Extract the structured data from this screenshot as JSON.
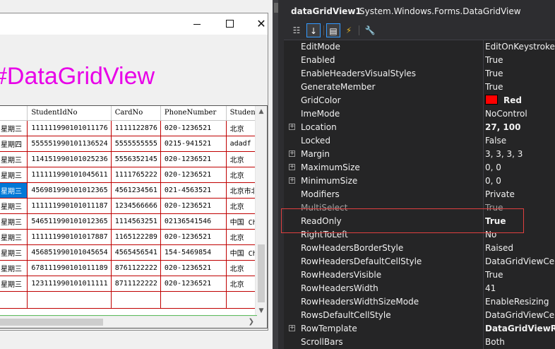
{
  "form": {
    "title": "#DataGridView",
    "window_buttons": {
      "close": "✕"
    }
  },
  "grid": {
    "columns": [
      "",
      "StudentIdNo",
      "CardNo",
      "PhoneNumber",
      "Student"
    ],
    "rows": [
      [
        "星期三",
        "111111990101011176",
        "1111122876",
        "020-1236521",
        "北京"
      ],
      [
        "星期四",
        "555551990101136524",
        "5555555555",
        "0215-941521",
        "adadf"
      ],
      [
        "星期三",
        "114151990101025236",
        "5556352145",
        "020-1236521",
        "北京"
      ],
      [
        "星期三",
        "111111990101045611",
        "1111765222",
        "020-1236521",
        "北京"
      ],
      [
        "星期三",
        "456981990101012365",
        "4561234561",
        "021-4563521",
        "北京市北"
      ],
      [
        "星期三",
        "111111990101011187",
        "1234566666",
        "020-1236521",
        "北京"
      ],
      [
        "星期三",
        "546511990101012365",
        "1114563251",
        "02136541546",
        "中国 Ch"
      ],
      [
        "星期三",
        "111111990101017887",
        "1165122289",
        "020-1236521",
        "北京"
      ],
      [
        "星期三",
        "456851990101045654",
        "4565456541",
        "154-5469854",
        "中国 Ch"
      ],
      [
        "星期三",
        "678111990101011189",
        "8761122222",
        "020-1236521",
        "北京"
      ],
      [
        "星期三",
        "123111990101011111",
        "8711122222",
        "020-1236521",
        "北京"
      ]
    ],
    "selected_row": 4
  },
  "properties": {
    "object_name": "dataGridView1",
    "object_type": "System.Windows.Forms.DataGridView",
    "grid_color_hex": "#ff0000",
    "items": [
      {
        "name": "EditMode",
        "value": "EditOnKeystrokeOrF2"
      },
      {
        "name": "Enabled",
        "value": "True"
      },
      {
        "name": "EnableHeadersVisualStyles",
        "value": "True"
      },
      {
        "name": "GenerateMember",
        "value": "True"
      },
      {
        "name": "GridColor",
        "value": "Red",
        "bold": true,
        "swatch": true
      },
      {
        "name": "ImeMode",
        "value": "NoControl"
      },
      {
        "name": "Location",
        "value": "27, 100",
        "bold": true,
        "expandable": true
      },
      {
        "name": "Locked",
        "value": "False"
      },
      {
        "name": "Margin",
        "value": "3, 3, 3, 3",
        "expandable": true
      },
      {
        "name": "MaximumSize",
        "value": "0, 0",
        "expandable": true
      },
      {
        "name": "MinimumSize",
        "value": "0, 0",
        "expandable": true
      },
      {
        "name": "Modifiers",
        "value": "Private"
      },
      {
        "name": "MultiSelect",
        "value": "True",
        "grey": true
      },
      {
        "name": "ReadOnly",
        "value": "True",
        "bold": true
      },
      {
        "name": "RightToLeft",
        "value": "No"
      },
      {
        "name": "RowHeadersBorderStyle",
        "value": "Raised"
      },
      {
        "name": "RowHeadersDefaultCellStyle",
        "value": "DataGridViewCellStyle"
      },
      {
        "name": "RowHeadersVisible",
        "value": "True"
      },
      {
        "name": "RowHeadersWidth",
        "value": "41"
      },
      {
        "name": "RowHeadersWidthSizeMode",
        "value": "EnableResizing"
      },
      {
        "name": "RowsDefaultCellStyle",
        "value": "DataGridViewCellStyle"
      },
      {
        "name": "RowTemplate",
        "value": "DataGridViewRow",
        "bold": true,
        "expandable": true
      },
      {
        "name": "ScrollBars",
        "value": "Both"
      }
    ]
  }
}
